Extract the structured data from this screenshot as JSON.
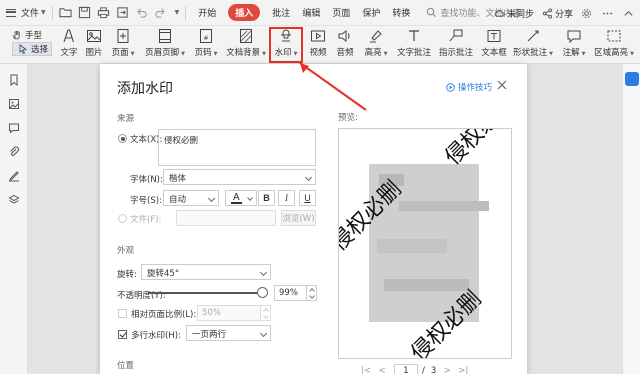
{
  "menubar": {
    "file_label": "文件",
    "tabs": [
      {
        "label": "开始",
        "active": false
      },
      {
        "label": "插入",
        "active": true
      },
      {
        "label": "批注",
        "active": false
      },
      {
        "label": "编辑",
        "active": false
      },
      {
        "label": "页面",
        "active": false
      },
      {
        "label": "保护",
        "active": false
      },
      {
        "label": "转换",
        "active": false
      }
    ],
    "search_placeholder": "查找功能、文档内容",
    "sync_label": "未同步",
    "share_label": "分享"
  },
  "ribbon": {
    "mode_hand": "手型",
    "mode_select": "选择",
    "buttons": [
      "文字",
      "图片",
      "页面",
      "页眉页脚",
      "页码",
      "文档背景",
      "水印",
      "视频",
      "音频",
      "高亮",
      "文字批注",
      "指示批注",
      "文本框",
      "形状批注",
      "注解",
      "区域高亮"
    ]
  },
  "dialog": {
    "title": "添加水印",
    "help_link": "操作技巧",
    "source_label": "来源",
    "text_radio_label": "文本(X):",
    "text_value": "侵权必删",
    "font_label": "字体(N):",
    "font_value": "楷体",
    "size_label": "字号(S):",
    "size_value": "自动",
    "bold": "B",
    "italic": "I",
    "underline": "U",
    "file_radio_label": "文件(F):",
    "browse_label": "浏览(W)",
    "appearance_label": "外观",
    "rotate_label": "旋转:",
    "rotate_value": "旋转45°",
    "opacity_label": "不透明度(Y):",
    "opacity_value": "99%",
    "relative_scale_label": "相对页面比例(L):",
    "relative_scale_value": "50%",
    "multiline_label": "多行水印(H):",
    "multiline_value": "一页两行",
    "position_label": "位置",
    "preview_label": "预览:",
    "page_current": "1",
    "page_sep": "/",
    "page_total": "3",
    "watermark_text": "侵权必删"
  },
  "colors": {
    "accent": "#e0483c",
    "link": "#2d7be5",
    "highlight_box": "#e8302b"
  }
}
